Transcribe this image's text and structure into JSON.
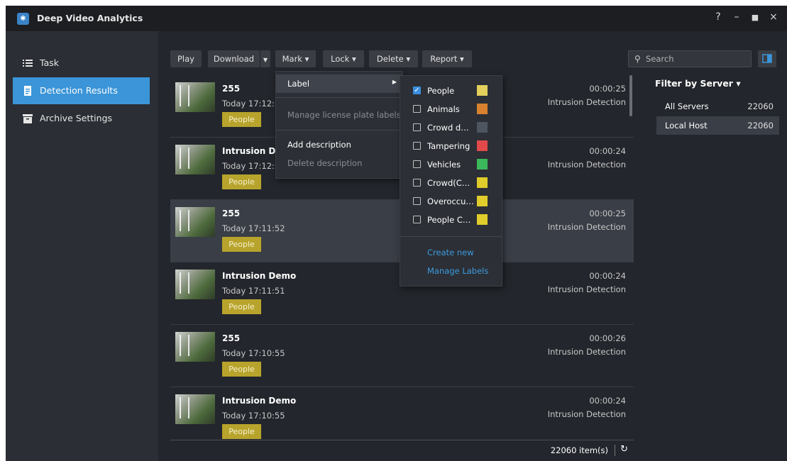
{
  "app": {
    "title": "Deep Video Analytics",
    "icon": "app-logo-icon"
  },
  "window_controls": {
    "help": "?",
    "minimize": "–",
    "maximize": "■",
    "close": "×"
  },
  "sidebar": {
    "items": [
      {
        "label": "Task",
        "icon": "list-icon",
        "active": false
      },
      {
        "label": "Detection Results",
        "icon": "document-icon",
        "active": true
      },
      {
        "label": "Archive Settings",
        "icon": "archive-icon",
        "active": false
      }
    ]
  },
  "toolbar": {
    "play": "Play",
    "download": "Download",
    "mark": "Mark ▾",
    "lock": "Lock ▾",
    "delete": "Delete ▾",
    "report": "Report ▾",
    "search_placeholder": "Search"
  },
  "results": [
    {
      "title": "255",
      "time": "Today 17:12:…",
      "tag": "People",
      "duration": "00:00:25",
      "event": "Intrusion Detection",
      "selected": false
    },
    {
      "title": "Intrusion De…",
      "time": "Today 17:12:…",
      "tag": "People",
      "duration": "00:00:24",
      "event": "Intrusion Detection",
      "selected": false
    },
    {
      "title": "255",
      "time": "Today 17:11:52",
      "tag": "People",
      "duration": "00:00:25",
      "event": "Intrusion Detection",
      "selected": true
    },
    {
      "title": "Intrusion Demo",
      "time": "Today 17:11:51",
      "tag": "People",
      "duration": "00:00:24",
      "event": "Intrusion Detection",
      "selected": false
    },
    {
      "title": "255",
      "time": "Today 17:10:55",
      "tag": "People",
      "duration": "00:00:26",
      "event": "Intrusion Detection",
      "selected": false
    },
    {
      "title": "Intrusion Demo",
      "time": "Today 17:10:55",
      "tag": "People",
      "duration": "00:00:24",
      "event": "Intrusion Detection",
      "selected": false
    }
  ],
  "status": {
    "count": "22060 item(s)"
  },
  "filter": {
    "header": "Filter by Server ▾",
    "servers": [
      {
        "name": "All Servers",
        "count": "22060",
        "selected": false
      },
      {
        "name": "Local Host",
        "count": "22060",
        "selected": true
      }
    ]
  },
  "mark_menu": {
    "label": "Label",
    "manage_plate": "Manage license plate labels",
    "add_description": "Add description",
    "delete_description": "Delete description"
  },
  "label_menu": {
    "labels": [
      {
        "name": "People",
        "checked": true,
        "color": "#e3cf5b"
      },
      {
        "name": "Animals",
        "checked": false,
        "color": "#d8822f"
      },
      {
        "name": "Crowd d…",
        "checked": false,
        "color": "#4d5560"
      },
      {
        "name": "Tampering",
        "checked": false,
        "color": "#e04a4a"
      },
      {
        "name": "Vehicles",
        "checked": false,
        "color": "#3bb85a"
      },
      {
        "name": "Crowd(C…",
        "checked": false,
        "color": "#e0cc2a"
      },
      {
        "name": "Overoccu…",
        "checked": false,
        "color": "#e0cc2a"
      },
      {
        "name": "People C…",
        "checked": false,
        "color": "#e0cc2a"
      }
    ],
    "create_new": "Create new",
    "manage_labels": "Manage Labels"
  }
}
